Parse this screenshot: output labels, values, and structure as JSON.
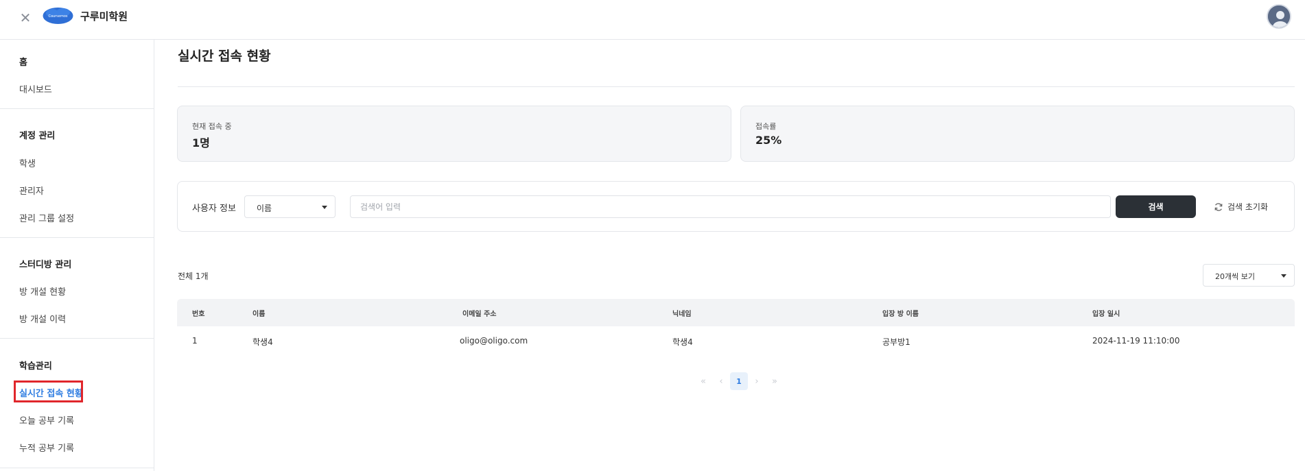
{
  "header": {
    "close_icon": "close-icon",
    "logo_text": "Coursemos",
    "org_name": "구루미학원",
    "accent_color": "#2f7de1"
  },
  "sidebar": {
    "groups": [
      {
        "title": "홈",
        "items": [
          "대시보드"
        ]
      },
      {
        "title": "계정 관리",
        "items": [
          "학생",
          "관리자",
          "관리 그룹 설정"
        ]
      },
      {
        "title": "스터디방 관리",
        "items": [
          "방 개설 현황",
          "방 개설 이력"
        ]
      },
      {
        "title": "학습관리",
        "items": [
          "실시간 접속 현황",
          "오늘 공부 기록",
          "누적 공부 기록"
        ]
      }
    ],
    "active_item": "실시간 접속 현황"
  },
  "main": {
    "title": "실시간 접속 현황",
    "stats": [
      {
        "label": "현재 접속 중",
        "value": "1명"
      },
      {
        "label": "접속률",
        "value": "25%"
      }
    ],
    "filter": {
      "label": "사용자 정보",
      "select_value": "이름",
      "search_placeholder": "검색어 입력",
      "search_button": "검색",
      "reset_button": "검색 초기화"
    },
    "total_count": "전체 1개",
    "page_size": "20개씩 보기",
    "table": {
      "columns": [
        "번호",
        "이름",
        "이메일 주소",
        "닉네임",
        "입장 방 이름",
        "입장 일시"
      ],
      "rows": [
        [
          "1",
          "학생4",
          "oligo@oligo.com",
          "학생4",
          "공부방1",
          "2024-11-19 11:10:00"
        ]
      ]
    },
    "pagination": {
      "first": "«",
      "prev": "‹",
      "current": "1",
      "next": "›",
      "last": "»"
    }
  }
}
